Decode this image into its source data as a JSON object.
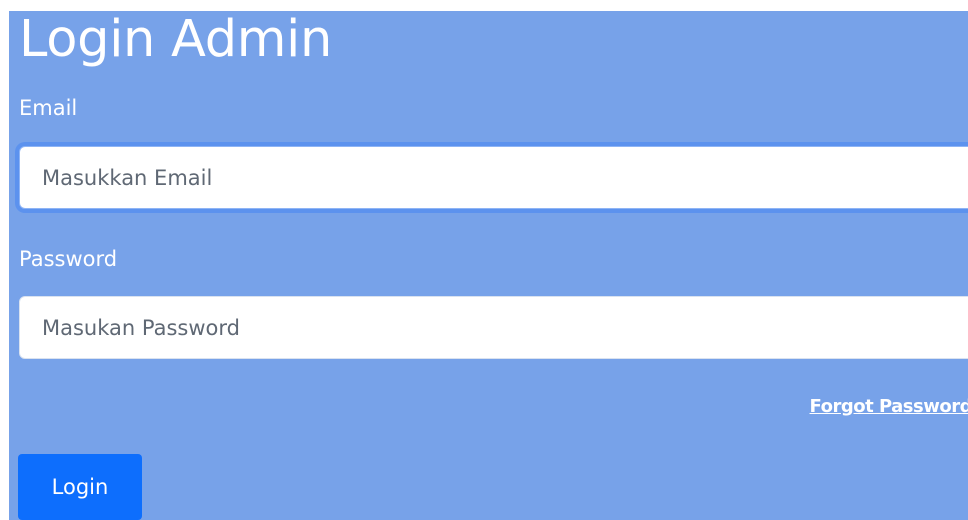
{
  "form": {
    "title": "Login Admin",
    "email_label": "Email",
    "email_placeholder": "Masukkan Email",
    "email_value": "",
    "password_label": "Password",
    "password_placeholder": "Masukan Password",
    "password_value": "",
    "forgot_label": "Forgot Password",
    "login_label": "Login"
  },
  "colors": {
    "panel_background": "#77a2e9",
    "primary_button": "#0d6efd",
    "focus_ring": "#5c92ee",
    "text_on_panel": "#ffffff"
  }
}
